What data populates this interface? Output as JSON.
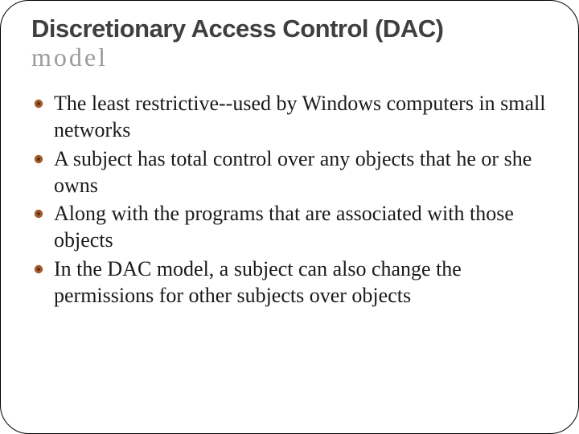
{
  "slide": {
    "title": "Discretionary Access Control (DAC)",
    "subtitle": "model",
    "bullets": [
      "The least restrictive--used by Windows computers in small networks",
      "A subject has total control over any objects that he or she owns",
      "Along with the programs that are associated with those objects",
      "In the DAC model, a subject can also change the permissions for other subjects over objects"
    ],
    "colors": {
      "title": "#3f3f3f",
      "subtitle": "#9b9b9b",
      "bullet_icon": "#a45b2a",
      "body_text": "#1a1a1a"
    }
  }
}
